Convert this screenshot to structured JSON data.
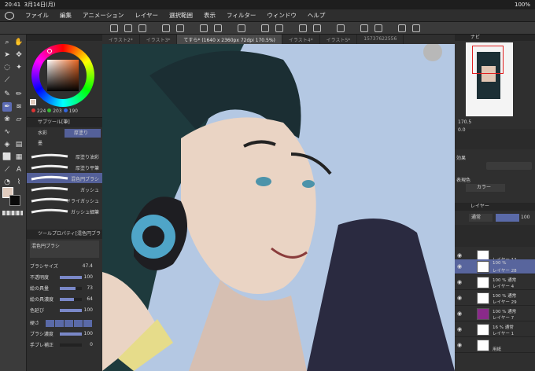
{
  "status": {
    "time": "20:41",
    "date": "3月14日(月)",
    "battery": "100%"
  },
  "menu": [
    "ファイル",
    "編集",
    "アニメーション",
    "レイヤー",
    "選択範囲",
    "表示",
    "フィルター",
    "ウィンドウ",
    "ヘルプ"
  ],
  "tabs": [
    {
      "label": "イラスト2*",
      "active": false
    },
    {
      "label": "イラスト3*",
      "active": false
    },
    {
      "label": "てすら* (1640 x 2360px 72dpi 170.5%)",
      "active": true
    },
    {
      "label": "イラスト4*",
      "active": false
    },
    {
      "label": "イラスト5*",
      "active": false
    },
    {
      "label": "15737622556",
      "active": false
    }
  ],
  "color": {
    "r": "224",
    "g": "203",
    "b": "190",
    "current": "#e0cbbe"
  },
  "subtool": {
    "title": "サブツール[筆]",
    "groups": [
      "水彩",
      "厚塗り",
      "墨"
    ],
    "brushes": [
      "厚塗り油彩",
      "厚塗り平筆",
      "混色円ブラシ",
      "ガッシュ",
      "ドライガッシュ",
      "ガッシュ細筆"
    ]
  },
  "toolprop": {
    "title": "ツールプロパティ[混色円ブラシ]",
    "name": "混色円ブラシ",
    "rows": [
      {
        "label": "ブラシサイズ",
        "value": "47.4",
        "pct": 0.55
      },
      {
        "label": "不透明度",
        "value": "100",
        "pct": 1.0
      },
      {
        "label": "絵の具量",
        "value": "73",
        "pct": 0.73
      },
      {
        "label": "絵の具濃度",
        "value": "64",
        "pct": 0.64
      },
      {
        "label": "色延び",
        "value": "100",
        "pct": 1.0
      },
      {
        "label": "硬さ",
        "value": "",
        "pct": 0
      },
      {
        "label": "ブラシ濃度",
        "value": "100",
        "pct": 1.0
      },
      {
        "label": "手ブレ補正",
        "value": "0",
        "pct": 0.0
      }
    ]
  },
  "navigator": {
    "title": "ナビ",
    "zoom": "170.5",
    "angle": "0.0"
  },
  "effect": {
    "title": "効果",
    "expression_label": "表現色",
    "expression": "カラー"
  },
  "layers": {
    "title": "レイヤー",
    "blend": "通常",
    "opacity": "100",
    "items": [
      {
        "pct": "",
        "name": "レイヤー 12",
        "sel": false
      },
      {
        "pct": "100 %",
        "name": "レイヤー 28",
        "sel": true
      },
      {
        "pct": "100 % 通常",
        "name": "レイヤー 4",
        "sel": false
      },
      {
        "pct": "100 % 通常",
        "name": "レイヤー 29",
        "sel": false
      },
      {
        "pct": "100 % 通常",
        "name": "レイヤー 7",
        "sel": false
      },
      {
        "pct": "16 % 通常",
        "name": "レイヤー 1",
        "sel": false
      },
      {
        "pct": "",
        "name": "用紙",
        "sel": false
      }
    ]
  }
}
